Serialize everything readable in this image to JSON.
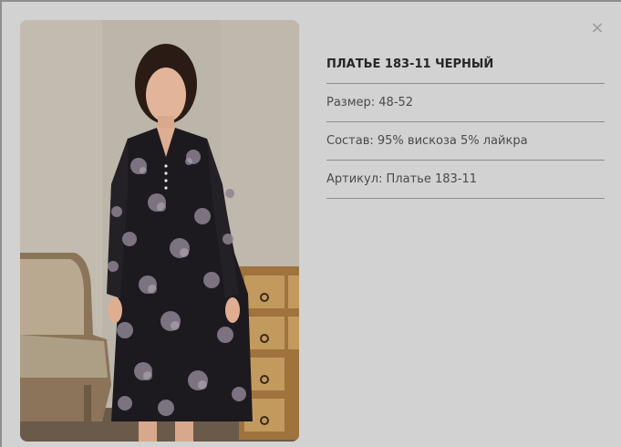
{
  "modal": {
    "close_glyph": "×",
    "product_title": "ПЛАТЬЕ 183-11 ЧЕРНЫЙ",
    "size_text": "Размер: 48-52",
    "composition_text": "Состав: 95% вискоза 5% лайкра",
    "article_text": "Артикул: Платье 183-11"
  },
  "colors": {
    "backdrop": "#8e8e8e",
    "modal_bg": "#d2d2d2",
    "divider": "#8c8c8c",
    "title_text": "#262626",
    "body_text": "#4a4a4a"
  },
  "icons": {
    "close": "close-icon"
  }
}
